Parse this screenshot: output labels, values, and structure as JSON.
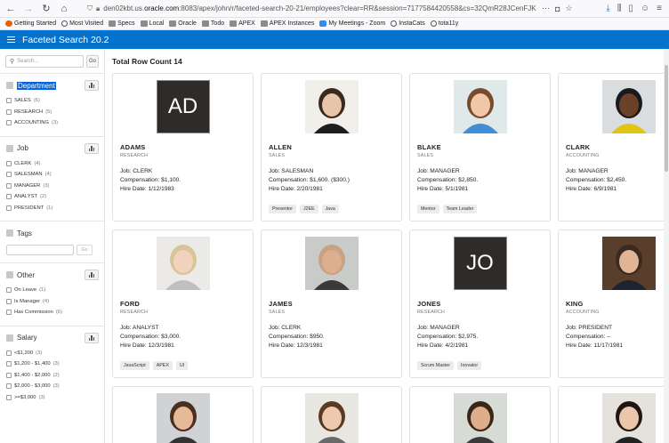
{
  "browser": {
    "url_prefix": "den02kbt.us.",
    "url_host": "oracle.com",
    "url_rest": ":8083/apex/john/r/faceted-search-20-21/employees?clear=RR&session=7177584420558&cs=32QmR28JCenFJKuFm3\\",
    "bookmarks": [
      "Getting Started",
      "Most Visited",
      "Specs",
      "Local",
      "Oracle",
      "Todo",
      "APEX",
      "APEX Instances",
      "My Meetings - Zoom",
      "InstaCats",
      "tota11y"
    ]
  },
  "app": {
    "title": "Faceted Search 20.2"
  },
  "search": {
    "placeholder": "Search...",
    "go_label": "Go"
  },
  "facets": {
    "department": {
      "title": "Department",
      "options": [
        {
          "label": "SALES",
          "count": "(6)"
        },
        {
          "label": "RESEARCH",
          "count": "(5)"
        },
        {
          "label": "ACCOUNTING",
          "count": "(3)"
        }
      ]
    },
    "job": {
      "title": "Job",
      "options": [
        {
          "label": "CLERK",
          "count": "(4)"
        },
        {
          "label": "SALESMAN",
          "count": "(4)"
        },
        {
          "label": "MANAGER",
          "count": "(3)"
        },
        {
          "label": "ANALYST",
          "count": "(2)"
        },
        {
          "label": "PRESIDENT",
          "count": "(1)"
        }
      ]
    },
    "tags": {
      "title": "Tags",
      "go_label": "Go"
    },
    "other": {
      "title": "Other",
      "options": [
        {
          "label": "On Leave",
          "count": "(1)"
        },
        {
          "label": "Is Manager",
          "count": "(4)"
        },
        {
          "label": "Has Commission",
          "count": "(6)"
        }
      ]
    },
    "salary": {
      "title": "Salary",
      "options": [
        {
          "label": "<$1,200",
          "count": "(3)"
        },
        {
          "label": "$1,200 - $1,400",
          "count": "(3)"
        },
        {
          "label": "$1,400 - $2,000",
          "count": "(2)"
        },
        {
          "label": "$2,000 - $3,000",
          "count": "(3)"
        },
        {
          "label": ">=$3,000",
          "count": "(3)"
        }
      ]
    }
  },
  "results": {
    "row_count_label": "Total Row Count 14",
    "employees": [
      {
        "name": "ADAMS",
        "dept": "RESEARCH",
        "job": "Job: CLERK",
        "comp": "Compensation: $1,100.",
        "hire": "Hire Date: 1/12/1983",
        "initials": "AD",
        "tags": []
      },
      {
        "name": "ALLEN",
        "dept": "SALES",
        "job": "Job: SALESMAN",
        "comp": "Compensation: $1,600. ($300.)",
        "hire": "Hire Date: 2/20/1981",
        "photo": "woman-blonde",
        "tags": [
          "Presentor",
          "J2EE",
          "Java"
        ]
      },
      {
        "name": "BLAKE",
        "dept": "SALES",
        "job": "Job: MANAGER",
        "comp": "Compensation: $2,850.",
        "hire": "Hire Date: 5/1/1981",
        "photo": "woman-brown",
        "tags": [
          "Mentor",
          "Team Leader"
        ]
      },
      {
        "name": "CLARK",
        "dept": "ACCOUNTING",
        "job": "Job: MANAGER",
        "comp": "Compensation: $2,450.",
        "hire": "Hire Date: 6/9/1981",
        "photo": "man-yellow-shirt",
        "tags": []
      },
      {
        "name": "FORD",
        "dept": "RESEARCH",
        "job": "Job: ANALYST",
        "comp": "Compensation: $3,000.",
        "hire": "Hire Date: 12/3/1981",
        "photo": "woman-short-blonde",
        "tags": [
          "JavaScript",
          "APEX",
          "UI"
        ]
      },
      {
        "name": "JAMES",
        "dept": "SALES",
        "job": "Job: CLERK",
        "comp": "Compensation: $950.",
        "hire": "Hire Date: 12/3/1981",
        "photo": "man-bald-scarf",
        "tags": []
      },
      {
        "name": "JONES",
        "dept": "RESEARCH",
        "job": "Job: MANAGER",
        "comp": "Compensation: $2,975.",
        "hire": "Hire Date: 4/2/1981",
        "initials": "JO",
        "tags": [
          "Scrum Master",
          "Inovator"
        ]
      },
      {
        "name": "KING",
        "dept": "ACCOUNTING",
        "job": "Job: PRESIDENT",
        "comp": "Compensation: --",
        "hire": "Hire Date: 11/17/1981",
        "photo": "man-suit",
        "tags": []
      }
    ]
  }
}
